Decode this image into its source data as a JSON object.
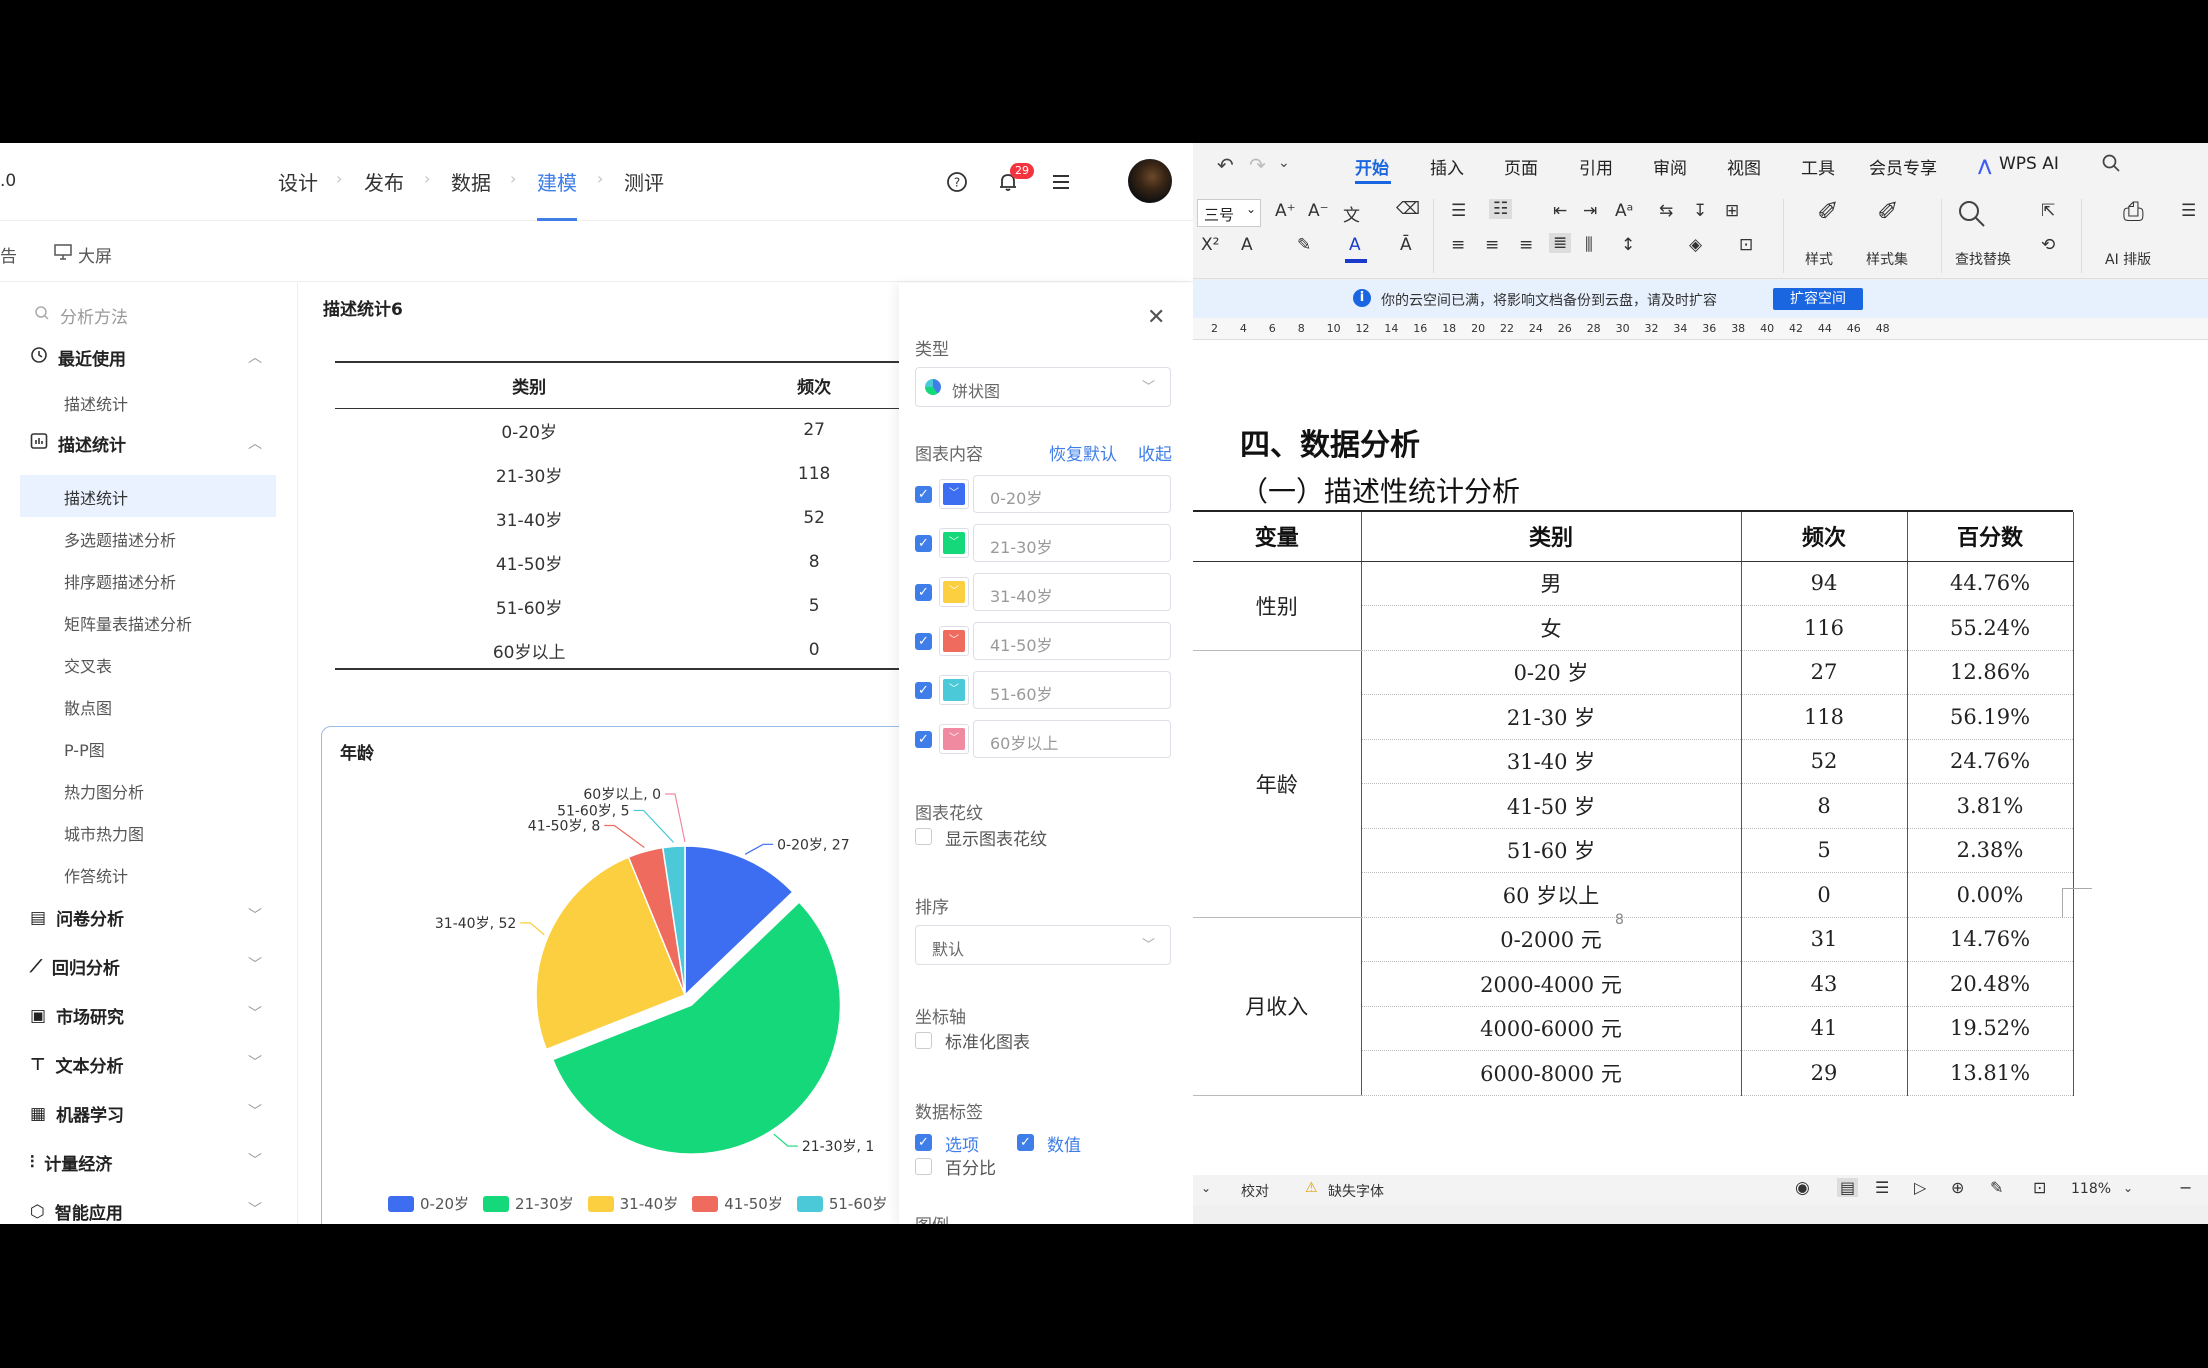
{
  "app": {
    "logo_fragment": ".0",
    "nav_steps": [
      "设计",
      "发布",
      "数据",
      "建模",
      "测评"
    ],
    "notification_count": "29",
    "subnav": {
      "left_fragment": "告",
      "bigscreen": "大屏"
    }
  },
  "sidebar": {
    "search_placeholder": "分析方法",
    "recent": "最近使用",
    "recent_item": "描述统计",
    "desc_group": "描述统计",
    "desc_items": [
      "描述统计",
      "多选题描述分析",
      "排序题描述分析",
      "矩阵量表描述分析",
      "交叉表",
      "散点图",
      "P-P图",
      "热力图分析",
      "城市热力图",
      "作答统计"
    ],
    "groups": [
      "问卷分析",
      "回归分析",
      "市场研究",
      "文本分析",
      "机器学习",
      "计量经济",
      "智能应用"
    ]
  },
  "content": {
    "section_title": "描述统计6",
    "table_headers": [
      "类别",
      "频次"
    ],
    "rows": [
      [
        "0-20岁",
        "27"
      ],
      [
        "21-30岁",
        "118"
      ],
      [
        "31-40岁",
        "52"
      ],
      [
        "41-50岁",
        "8"
      ],
      [
        "51-60岁",
        "5"
      ],
      [
        "60岁以上",
        "0"
      ]
    ],
    "chart_title": "年龄",
    "pie_labels": [
      "0-20岁, 27",
      "21-30岁, 1",
      "31-40岁, 52",
      "41-50岁, 8",
      "51-60岁, 5",
      "60岁以上, 0"
    ],
    "legend": [
      "0-20岁",
      "21-30岁",
      "31-40岁",
      "41-50岁",
      "51-60岁"
    ]
  },
  "chart_data": {
    "type": "pie",
    "title": "年龄",
    "categories": [
      "0-20岁",
      "21-30岁",
      "31-40岁",
      "41-50岁",
      "51-60岁",
      "60岁以上"
    ],
    "values": [
      27,
      118,
      52,
      8,
      5,
      0
    ],
    "colors": [
      "#3d6df0",
      "#14d87a",
      "#fbcf3f",
      "#ef6b5d",
      "#4cc9d8",
      "#f08aa0"
    ],
    "legend_position": "bottom"
  },
  "panel": {
    "type_label": "类型",
    "type_value": "饼状图",
    "content_label": "图表内容",
    "restore": "恢复默认",
    "collapse": "收起",
    "series": [
      "0-20岁",
      "21-30岁",
      "31-40岁",
      "41-50岁",
      "51-60岁",
      "60岁以上"
    ],
    "pattern_label": "图表花纹",
    "pattern_option": "显示图表花纹",
    "sort_label": "排序",
    "sort_value": "默认",
    "axis_label": "坐标轴",
    "axis_option": "标准化图表",
    "datalabel_label": "数据标签",
    "opt_option": "选项",
    "opt_value": "数值",
    "opt_percent": "百分比",
    "legend_label": "图例"
  },
  "wps": {
    "tabs": [
      "开始",
      "插入",
      "页面",
      "引用",
      "审阅",
      "视图",
      "工具",
      "会员专享",
      "WPS AI"
    ],
    "font_size": "三号",
    "style_btn": "样式",
    "styleset_btn": "样式集",
    "find_btn": "查找替换",
    "ai_btn": "AI 排版",
    "notice": "你的云空间已满，将影响文档备份到云盘，请及时扩容",
    "notice_btn": "扩容空间",
    "ruler": [
      "2",
      "4",
      "6",
      "8",
      "10",
      "12",
      "14",
      "16",
      "18",
      "20",
      "22",
      "24",
      "26",
      "28",
      "30",
      "32",
      "34",
      "36",
      "38",
      "40",
      "42",
      "44",
      "46",
      "48"
    ],
    "heading1": "四、数据分析",
    "heading2": "（一）描述性统计分析",
    "table_headers": [
      "变量",
      "类别",
      "频次",
      "百分数"
    ],
    "groups": [
      {
        "name": "性别",
        "rows": [
          [
            "男",
            "94",
            "44.76%"
          ],
          [
            "女",
            "116",
            "55.24%"
          ]
        ]
      },
      {
        "name": "年龄",
        "rows": [
          [
            "0-20 岁",
            "27",
            "12.86%"
          ],
          [
            "21-30 岁",
            "118",
            "56.19%"
          ],
          [
            "31-40 岁",
            "52",
            "24.76%"
          ],
          [
            "41-50 岁",
            "8",
            "3.81%"
          ],
          [
            "51-60 岁",
            "5",
            "2.38%"
          ],
          [
            "60 岁以上",
            "0",
            "0.00%"
          ]
        ]
      },
      {
        "name": "月收入",
        "rows": [
          [
            "0-2000 元",
            "31",
            "14.76%"
          ],
          [
            "2000-4000 元",
            "43",
            "20.48%"
          ],
          [
            "4000-6000 元",
            "41",
            "19.52%"
          ],
          [
            "6000-8000 元",
            "29",
            "13.81%"
          ]
        ]
      }
    ],
    "page_number": "8",
    "status": {
      "proof": "校对",
      "missing_font": "缺失字体",
      "zoom": "118%"
    }
  }
}
